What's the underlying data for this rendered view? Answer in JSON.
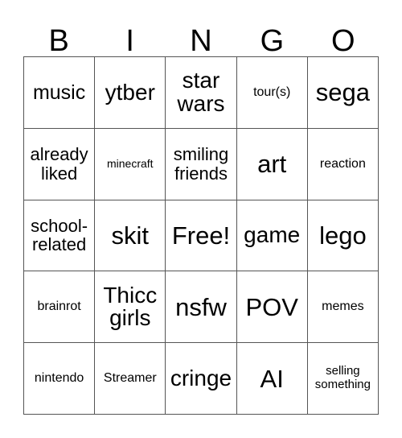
{
  "card": {
    "type": "bingo-card",
    "columns": 5,
    "rows": 5,
    "background_color": "#ffffff",
    "text_color": "#000000",
    "border_color": "#555555",
    "header_letters": [
      "B",
      "I",
      "N",
      "G",
      "O"
    ],
    "free_space": {
      "row": 3,
      "column": 3,
      "label": "Free!"
    },
    "cells": [
      [
        {
          "label": "music",
          "size": "lg"
        },
        {
          "label": "ytber",
          "size": "xl"
        },
        {
          "label": "star\nwars",
          "size": "xl"
        },
        {
          "label": "tour(s)",
          "size": "smd"
        },
        {
          "label": "sega",
          "size": "xxl"
        }
      ],
      [
        {
          "label": "already\nliked",
          "size": "md"
        },
        {
          "label": "minecraft",
          "size": "xs"
        },
        {
          "label": "smiling\nfriends",
          "size": "md"
        },
        {
          "label": "art",
          "size": "xxl"
        },
        {
          "label": "reaction",
          "size": "smd"
        }
      ],
      [
        {
          "label": "school-\nrelated",
          "size": "md"
        },
        {
          "label": "skit",
          "size": "xxl"
        },
        {
          "label": "Free!",
          "size": "xxl"
        },
        {
          "label": "game",
          "size": "xl"
        },
        {
          "label": "lego",
          "size": "xxl"
        }
      ],
      [
        {
          "label": "brainrot",
          "size": "smd"
        },
        {
          "label": "Thicc\ngirls",
          "size": "xl"
        },
        {
          "label": "nsfw",
          "size": "xxl"
        },
        {
          "label": "POV",
          "size": "xxl"
        },
        {
          "label": "memes",
          "size": "smd"
        }
      ],
      [
        {
          "label": "nintendo",
          "size": "smd"
        },
        {
          "label": "Streamer",
          "size": "smd"
        },
        {
          "label": "cringe",
          "size": "xl"
        },
        {
          "label": "AI",
          "size": "xxl"
        },
        {
          "label": "selling\nsomething",
          "size": "sm"
        }
      ]
    ]
  }
}
